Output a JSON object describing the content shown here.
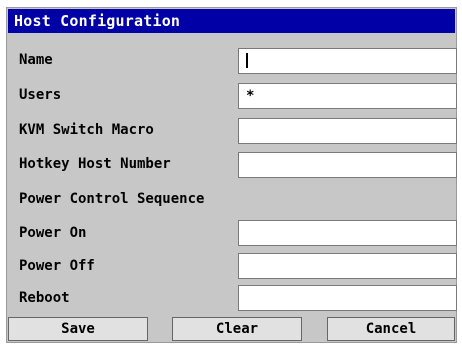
{
  "dialog": {
    "title": "Host Configuration"
  },
  "fields": {
    "name": {
      "label": "Name",
      "value": ""
    },
    "users": {
      "label": "Users",
      "value": "*"
    },
    "kvm_switch_macro": {
      "label": "KVM Switch Macro",
      "value": ""
    },
    "hotkey_host_number": {
      "label": "Hotkey Host Number",
      "value": ""
    }
  },
  "power_section": {
    "heading": "Power Control Sequence",
    "power_on": {
      "label": "Power On",
      "value": ""
    },
    "power_off": {
      "label": "Power Off",
      "value": ""
    },
    "reboot": {
      "label": "Reboot",
      "value": ""
    }
  },
  "buttons": {
    "save": "Save",
    "clear": "Clear",
    "cancel": "Cancel"
  },
  "colors": {
    "title_bar": "#0000a6",
    "dialog_bg": "#c7c7c7",
    "field_bg": "#ffffff"
  }
}
